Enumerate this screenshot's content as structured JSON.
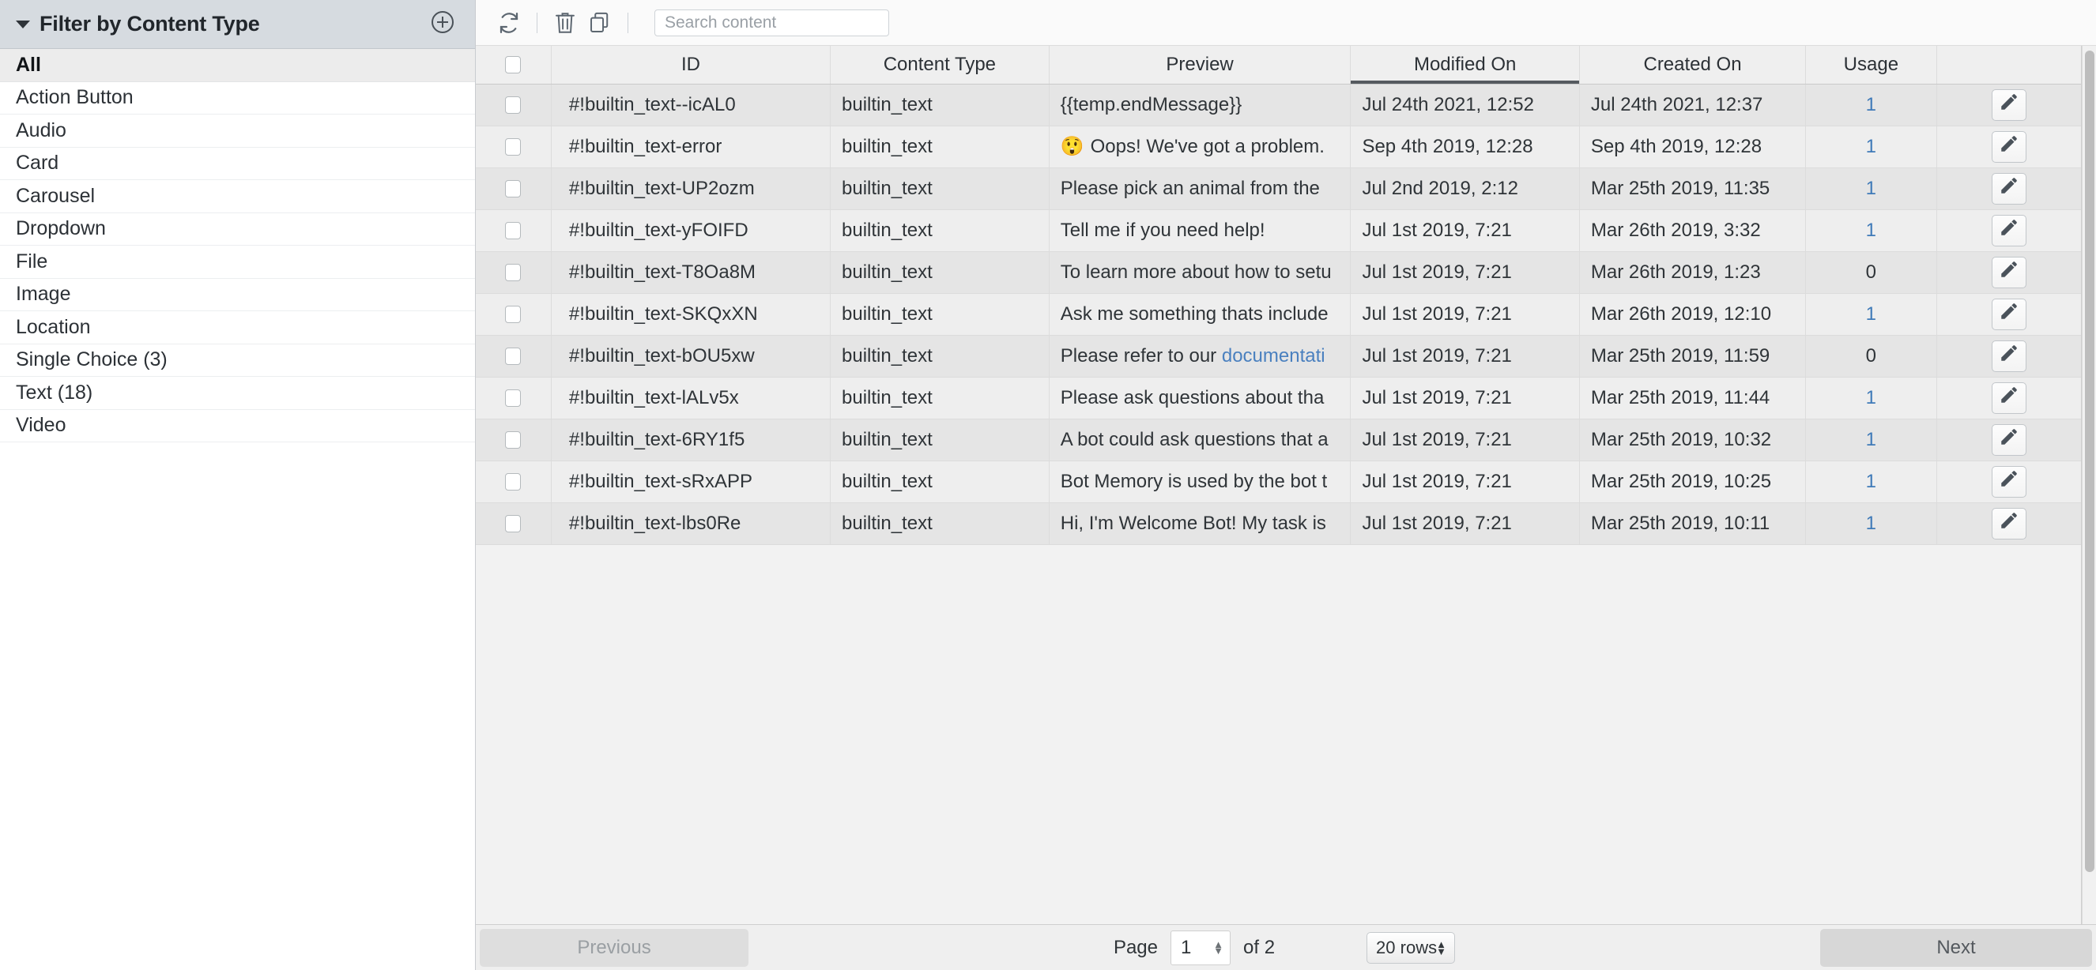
{
  "sidebar": {
    "title": "Filter by Content Type",
    "caret_icon": "caret-down-icon",
    "add_icon": "plus-circle-icon",
    "items": [
      {
        "label": "All",
        "active": true
      },
      {
        "label": "Action Button",
        "active": false
      },
      {
        "label": "Audio",
        "active": false
      },
      {
        "label": "Card",
        "active": false
      },
      {
        "label": "Carousel",
        "active": false
      },
      {
        "label": "Dropdown",
        "active": false
      },
      {
        "label": "File",
        "active": false
      },
      {
        "label": "Image",
        "active": false
      },
      {
        "label": "Location",
        "active": false
      },
      {
        "label": "Single Choice (3)",
        "active": false
      },
      {
        "label": "Text (18)",
        "active": false
      },
      {
        "label": "Video",
        "active": false
      }
    ]
  },
  "toolbar": {
    "refresh_icon": "refresh-icon",
    "delete_icon": "trash-icon",
    "duplicate_icon": "copy-icon",
    "search": {
      "value": "",
      "placeholder": "Search content"
    }
  },
  "table": {
    "columns": [
      {
        "key": "check",
        "label": "",
        "sorted": false
      },
      {
        "key": "id",
        "label": "ID",
        "sorted": false
      },
      {
        "key": "type",
        "label": "Content Type",
        "sorted": false
      },
      {
        "key": "preview",
        "label": "Preview",
        "sorted": false
      },
      {
        "key": "mod",
        "label": "Modified On",
        "sorted": true
      },
      {
        "key": "created",
        "label": "Created On",
        "sorted": false
      },
      {
        "key": "usage",
        "label": "Usage",
        "sorted": false
      },
      {
        "key": "edit",
        "label": "",
        "sorted": false
      }
    ],
    "edit_icon": "pencil-icon",
    "rows": [
      {
        "id": "#!builtin_text--icAL0",
        "type": "builtin_text",
        "preview": "{{temp.endMessage}}",
        "preview_emoji": "",
        "preview_link": "",
        "modified_on": "Jul 24th 2021, 12:52",
        "created_on": "Jul 24th 2021, 12:37",
        "usage": "1"
      },
      {
        "id": "#!builtin_text-error",
        "type": "builtin_text",
        "preview": "Oops! We've got a problem.",
        "preview_emoji": "😲",
        "preview_link": "",
        "modified_on": "Sep 4th 2019, 12:28",
        "created_on": "Sep 4th 2019, 12:28",
        "usage": "1"
      },
      {
        "id": "#!builtin_text-UP2ozm",
        "type": "builtin_text",
        "preview": "Please pick an animal from the",
        "preview_emoji": "",
        "preview_link": "",
        "modified_on": "Jul 2nd 2019, 2:12",
        "created_on": "Mar 25th 2019, 11:35",
        "usage": "1"
      },
      {
        "id": "#!builtin_text-yFOIFD",
        "type": "builtin_text",
        "preview": "Tell me if you need help!",
        "preview_emoji": "",
        "preview_link": "",
        "modified_on": "Jul 1st 2019, 7:21",
        "created_on": "Mar 26th 2019, 3:32",
        "usage": "1"
      },
      {
        "id": "#!builtin_text-T8Oa8M",
        "type": "builtin_text",
        "preview": "To learn more about how to setu",
        "preview_emoji": "",
        "preview_link": "",
        "modified_on": "Jul 1st 2019, 7:21",
        "created_on": "Mar 26th 2019, 1:23",
        "usage": "0"
      },
      {
        "id": "#!builtin_text-SKQxXN",
        "type": "builtin_text",
        "preview": "Ask me something thats include",
        "preview_emoji": "",
        "preview_link": "",
        "modified_on": "Jul 1st 2019, 7:21",
        "created_on": "Mar 26th 2019, 12:10",
        "usage": "1"
      },
      {
        "id": "#!builtin_text-bOU5xw",
        "type": "builtin_text",
        "preview": "Please refer to our ",
        "preview_emoji": "",
        "preview_link": "documentati",
        "modified_on": "Jul 1st 2019, 7:21",
        "created_on": "Mar 25th 2019, 11:59",
        "usage": "0"
      },
      {
        "id": "#!builtin_text-lALv5x",
        "type": "builtin_text",
        "preview": "Please ask questions about tha",
        "preview_emoji": "",
        "preview_link": "",
        "modified_on": "Jul 1st 2019, 7:21",
        "created_on": "Mar 25th 2019, 11:44",
        "usage": "1"
      },
      {
        "id": "#!builtin_text-6RY1f5",
        "type": "builtin_text",
        "preview": "A bot could ask questions that a",
        "preview_emoji": "",
        "preview_link": "",
        "modified_on": "Jul 1st 2019, 7:21",
        "created_on": "Mar 25th 2019, 10:32",
        "usage": "1"
      },
      {
        "id": "#!builtin_text-sRxAPP",
        "type": "builtin_text",
        "preview": "Bot Memory is used by the bot t",
        "preview_emoji": "",
        "preview_link": "",
        "modified_on": "Jul 1st 2019, 7:21",
        "created_on": "Mar 25th 2019, 10:25",
        "usage": "1"
      },
      {
        "id": "#!builtin_text-lbs0Re",
        "type": "builtin_text",
        "preview": "Hi, I'm Welcome Bot! My task is",
        "preview_emoji": "",
        "preview_link": "",
        "modified_on": "Jul 1st 2019, 7:21",
        "created_on": "Mar 25th 2019, 10:11",
        "usage": "1"
      }
    ]
  },
  "pagination": {
    "previous_label": "Previous",
    "next_label": "Next",
    "page_label": "Page",
    "page_value": "1",
    "of_label": "of 2",
    "rows_per_page": "20 rows"
  }
}
